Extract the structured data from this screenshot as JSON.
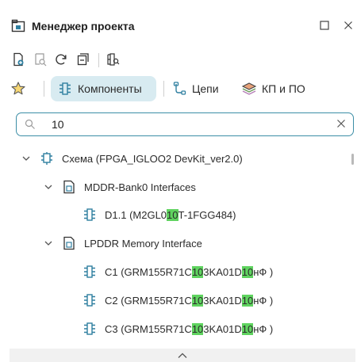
{
  "header": {
    "title": "Менеджер проекта",
    "icons": {
      "app": "project-manager-icon",
      "maximize": "maximize-icon",
      "close": "close-icon"
    }
  },
  "toolbar": {
    "icons": [
      "add-file-icon",
      "zoom-fit-icon",
      "refresh-icon",
      "collapse-all-icon",
      "find-component-icon"
    ]
  },
  "views": {
    "favorites_icon": "star-icon",
    "tabs": [
      {
        "label": "Компоненты",
        "icon": "component-icon",
        "active": true
      },
      {
        "label": "Цепи",
        "icon": "net-icon",
        "active": false
      },
      {
        "label": "КП и ПО",
        "icon": "pads-icon",
        "active": false
      }
    ]
  },
  "search": {
    "value": "10",
    "icons": {
      "search": "search-icon",
      "clear": "clear-icon"
    }
  },
  "tree": {
    "root": {
      "label": "Схема (FPGA_IGLOO2 DevKit_ver2.0)",
      "icon": "schematic-icon",
      "expanded": true
    },
    "groups": [
      {
        "label": "MDDR-Bank0 Interfaces",
        "icon": "sheet-icon",
        "expanded": true,
        "items": [
          {
            "pre": "D1.1 (M2GL0",
            "match": "10",
            "post": "T-1FGG484)"
          }
        ]
      },
      {
        "label": "LPDDR Memory Interface",
        "icon": "sheet-icon",
        "expanded": true,
        "items": [
          {
            "pre": "C1 (GRM155R71C",
            "match": "10",
            "mid": "3KA01D ",
            "match2": "10",
            "post": " нФ )"
          },
          {
            "pre": "C2 (GRM155R71C",
            "match": "10",
            "mid": "3KA01D ",
            "match2": "10",
            "post": " нФ )"
          },
          {
            "pre": "C3 (GRM155R71C",
            "match": "10",
            "mid": "3KA01D ",
            "match2": "10",
            "post": " нФ )"
          }
        ]
      }
    ]
  },
  "bottom_bar": {
    "icon": "chevron-up-icon"
  },
  "colors": {
    "accent": "#3c8ea6",
    "tab_active_bg": "#d8ebf1",
    "match_highlight": "#5fd35f",
    "icon_blue": "#2f7fa0"
  }
}
